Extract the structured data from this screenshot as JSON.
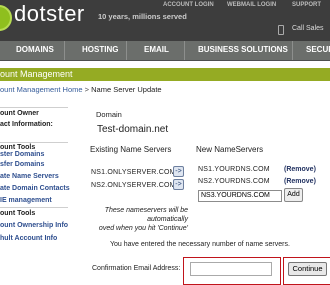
{
  "header": {
    "logo_text": "dotster",
    "tagline": "10 years, millions served",
    "links": [
      "ACCOUNT LOGIN",
      "WEBMAIL LOGIN",
      "SUPPORT"
    ],
    "sales_label": "Call Sales",
    "bg_color": "#3d3d3d",
    "logo_color": "#8fbf1e"
  },
  "nav": {
    "items": [
      "DOMAINS",
      "HOSTING",
      "EMAIL",
      "BUSINESS SOLUTIONS",
      "SECUR"
    ]
  },
  "page": {
    "title": "ount Management",
    "title_bar_color": "#95ab23"
  },
  "breadcrumb": {
    "link": "ount Management Home",
    "separator": " > ",
    "current": "Name Server Update"
  },
  "sidebar": {
    "owner_heading": "ount Owner",
    "owner_info": "act Information:",
    "tools_heading": "ount Tools",
    "tools": [
      "ster Domains",
      "sfer Domains",
      "ate Name Servers",
      "ate Domain Contacts",
      "IE management"
    ],
    "tools2_heading": "ount Tools",
    "tools2": [
      "ount Ownership Info",
      "hult Account Info"
    ]
  },
  "main": {
    "domain_label": "Domain",
    "domain_value": "Test-domain.net",
    "existing_header": "Existing Name Servers",
    "existing": [
      "NS1.ONLYSERVER.COM",
      "NS2.ONLYSERVER.COM"
    ],
    "arrow_glyph": "->",
    "new_header": "New NameServers",
    "new_ns": [
      "NS1.YOURDNS.COM",
      "NS2.YOURDNS.COM"
    ],
    "remove_label": "(Remove)",
    "input_value": "NS3.YOURDNS.COM",
    "add_label": "Add",
    "note_lines": [
      "These nameservers will be",
      "automatically",
      "oved when you hit 'Continue'"
    ],
    "enough_msg": "You have entered the necessary number of name servers.",
    "confirm_label": "Confirmation Email Address:",
    "confirm_value": "",
    "continue_label": "Continue",
    "highlight_color": "#c0141b"
  }
}
